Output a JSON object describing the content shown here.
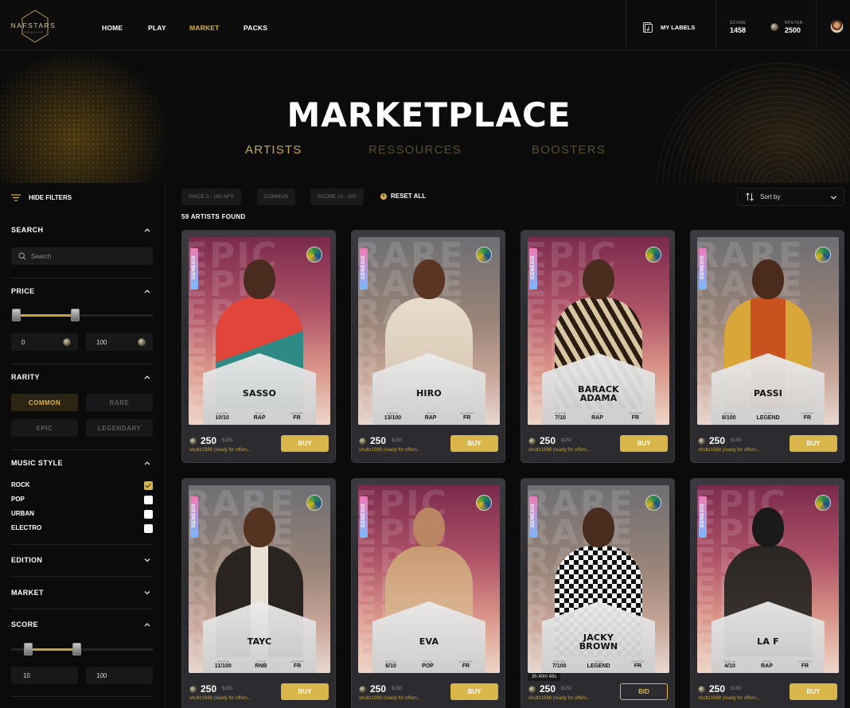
{
  "header": {
    "logo_text": "NAFSTARS",
    "logo_sub": "GENESIS",
    "nav": [
      {
        "label": "HOME"
      },
      {
        "label": "PLAY"
      },
      {
        "label": "MARKET"
      },
      {
        "label": "PACKS"
      }
    ],
    "active_nav": "MARKET",
    "labels_button": "MY LABELS",
    "score_label": "SCORE",
    "score_value": "1458",
    "nfstar_label": "NFSTAR",
    "nfstar_value": "2500"
  },
  "hero": {
    "title": "MARKETPLACE",
    "tabs": [
      {
        "label": "ARTISTS"
      },
      {
        "label": "RESSOURCES"
      },
      {
        "label": "BOOSTERS"
      }
    ],
    "active_tab": "ARTISTS"
  },
  "filters": {
    "hide_label": "HIDE FILTERS",
    "search": {
      "title": "SEARCH",
      "placeholder": "Search"
    },
    "price": {
      "title": "PRICE",
      "min": "0",
      "max": "100",
      "range_low": 0,
      "range_high": 0.43
    },
    "rarity": {
      "title": "RARITY",
      "options": [
        "COMMON",
        "RARE",
        "EPIC",
        "LEGENDARY"
      ],
      "selected": "COMMON"
    },
    "music_style": {
      "title": "MUSIC STYLE",
      "options": [
        {
          "label": "ROCK",
          "checked": true
        },
        {
          "label": "POP",
          "checked": false
        },
        {
          "label": "URBAN",
          "checked": false
        },
        {
          "label": "ELECTRO",
          "checked": false
        }
      ]
    },
    "edition_title": "EDITION",
    "market_title": "MARKET",
    "score": {
      "title": "SCORE",
      "min": "10",
      "max": "100",
      "range_low": 0.12,
      "range_high": 0.46
    }
  },
  "active_chips": [
    "PRICE 0 - 100 NFS",
    "COMMUN",
    "SCORE 10 - 100"
  ],
  "reset_label": "RESET ALL",
  "sort_label": "Sort by",
  "results_label": "59 ARTISTS FOUND",
  "card_common": {
    "genesis": "GENESIS",
    "stat_labels": [
      "EDITION",
      "STYLE",
      "COUNTRY"
    ],
    "usd": "$150",
    "seller": "shultz1988 (ready for offers..."
  },
  "cards": [
    {
      "name": "SASSO",
      "rarity": "EPIC",
      "edition": "10/10",
      "style": "RAP",
      "country": "FR",
      "price": "250",
      "action": "BUY"
    },
    {
      "name": "HIRO",
      "rarity": "RARE",
      "edition": "13/100",
      "style": "RAP",
      "country": "FR",
      "price": "250",
      "action": "BUY"
    },
    {
      "name": "BARACK ADAMA",
      "rarity": "EPIC",
      "edition": "7/10",
      "style": "RAP",
      "country": "FR",
      "price": "250",
      "action": "BUY"
    },
    {
      "name": "PASSI",
      "rarity": "RARE",
      "edition": "8/100",
      "style": "LEGEND",
      "country": "FR",
      "price": "250",
      "action": "BUY"
    },
    {
      "name": "TAYC",
      "rarity": "RARE",
      "edition": "11/100",
      "style": "RNB",
      "country": "FR",
      "price": "250",
      "action": "BUY"
    },
    {
      "name": "EVA",
      "rarity": "EPIC",
      "edition": "6/10",
      "style": "POP",
      "country": "FR",
      "price": "250",
      "action": "BUY"
    },
    {
      "name": "JACKY BROWN",
      "rarity": "RARE",
      "edition": "7/100",
      "style": "LEGEND",
      "country": "FR",
      "price": "250",
      "action": "BID",
      "timer": "3h 40m 48s"
    },
    {
      "name": "LA F",
      "rarity": "EPIC",
      "edition": "4/10",
      "style": "RAP",
      "country": "FR",
      "price": "250",
      "action": "BUY"
    }
  ],
  "colors": {
    "accent": "#d9b54a",
    "background": "#0b0b0c",
    "card": "#2e2e33"
  }
}
